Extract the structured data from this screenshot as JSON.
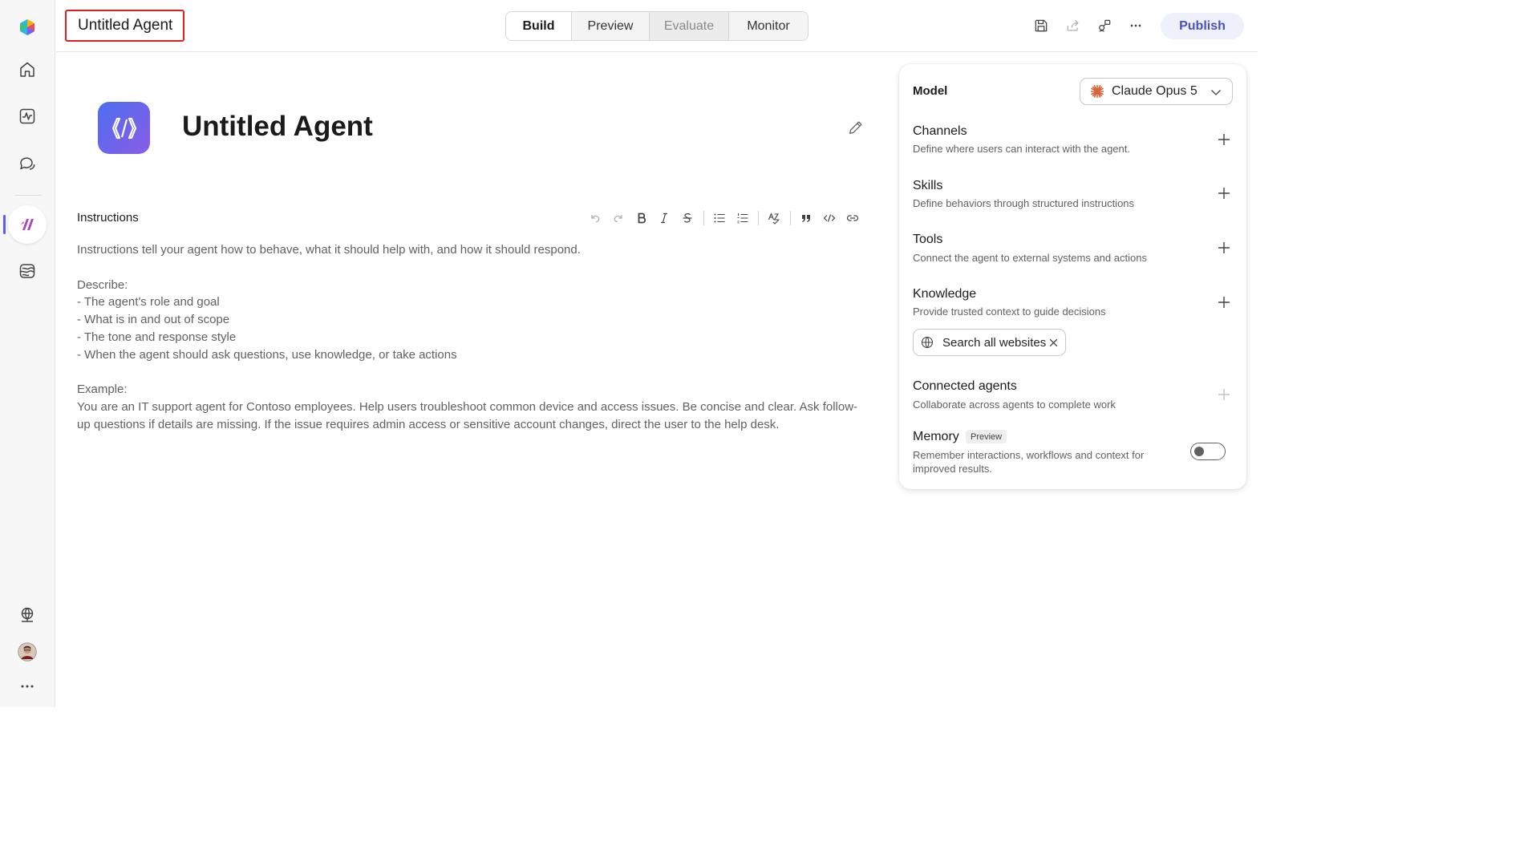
{
  "header": {
    "title": "Untitled Agent",
    "tabs": [
      {
        "label": "Build",
        "state": "active"
      },
      {
        "label": "Preview",
        "state": "normal"
      },
      {
        "label": "Evaluate",
        "state": "disabled"
      },
      {
        "label": "Monitor",
        "state": "normal"
      }
    ],
    "icons": [
      "save-icon",
      "share-icon",
      "connections-icon",
      "more-icon"
    ],
    "publish_label": "Publish"
  },
  "rail": {
    "items": [
      "app-logo-icon",
      "home-icon",
      "activity-icon",
      "chat-icon",
      "agents-icon",
      "library-icon"
    ],
    "bottom_items": [
      "globe-network-icon",
      "avatar",
      "more-icon"
    ],
    "accent_color": "#5b5fe8"
  },
  "agent": {
    "name": "Untitled Agent",
    "logo_gradient": [
      "#4c6ef0",
      "#8b5ce6"
    ]
  },
  "instructions": {
    "label": "Instructions",
    "paragraphs": [
      "Instructions tell your agent how to behave, what it should help with, and how it should respond.",
      "Describe:\n- The agent's role and goal\n- What is in and out of scope\n- The tone and response style\n- When the agent should ask questions, use knowledge, or take actions",
      "Example:\nYou are an IT support agent for Contoso employees. Help users troubleshoot common device and access issues. Be concise and clear. Ask follow-up questions if details are missing. If the issue requires admin access or sensitive account changes, direct the user to the help desk."
    ],
    "toolbar": [
      "undo-icon",
      "redo-icon",
      "bold-icon",
      "italic-icon",
      "strikethrough-icon",
      "bullet-list-icon",
      "numbered-list-icon",
      "spellcheck-icon",
      "quote-icon",
      "code-icon",
      "link-icon"
    ]
  },
  "panel": {
    "model_label": "Model",
    "model_value": "Claude Opus 5",
    "sections": [
      {
        "title": "Channels",
        "description": "Define where users can interact with the agent.",
        "add_enabled": true
      },
      {
        "title": "Skills",
        "description": "Define behaviors through structured instructions",
        "add_enabled": true
      },
      {
        "title": "Tools",
        "description": "Connect the agent to external systems and actions",
        "add_enabled": true
      },
      {
        "title": "Knowledge",
        "description": "Provide trusted context to guide decisions",
        "add_enabled": true
      },
      {
        "title": "Connected agents",
        "description": "Collaborate across agents to complete work",
        "add_enabled": false
      }
    ],
    "knowledge_chip": "Search all websites",
    "memory": {
      "title": "Memory",
      "badge": "Preview",
      "description": "Remember interactions, workflows and context for improved results.",
      "enabled": false
    }
  }
}
